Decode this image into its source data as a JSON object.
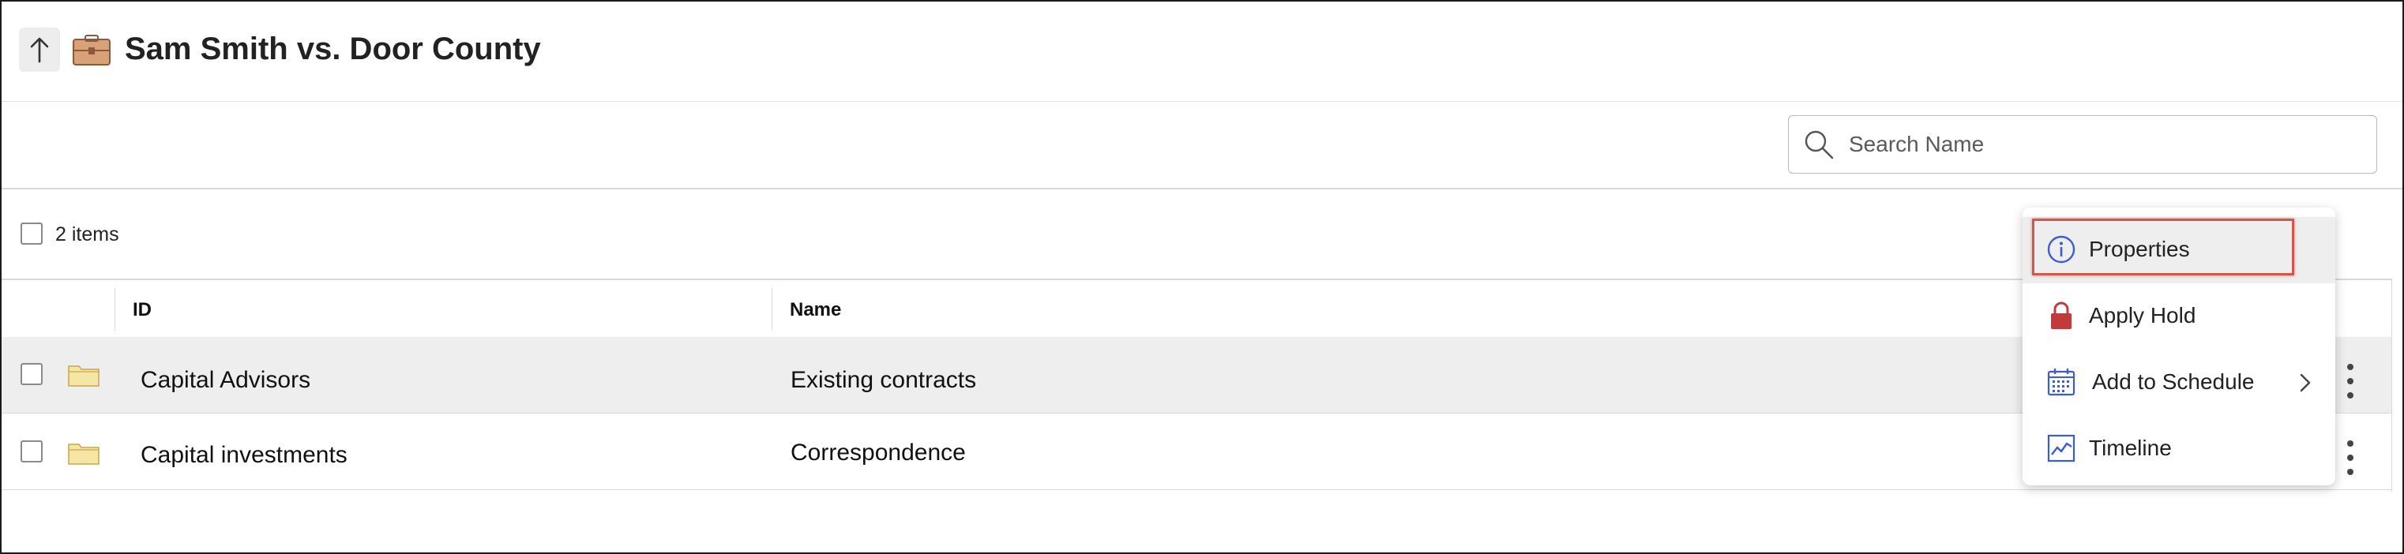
{
  "header": {
    "title": "Sam Smith vs. Door County",
    "up_icon": "arrow-up-icon",
    "case_icon": "briefcase-icon"
  },
  "search": {
    "placeholder": "Search Name",
    "value": ""
  },
  "list": {
    "count_label": "2 items"
  },
  "table": {
    "columns": [
      {
        "label": "ID"
      },
      {
        "label": "Name"
      }
    ],
    "rows": [
      {
        "id": "Capital Advisors",
        "name": "Existing contracts",
        "selected": true
      },
      {
        "id": "Capital investments",
        "name": "Correspondence",
        "selected": false
      }
    ]
  },
  "context_menu": {
    "items": [
      {
        "label": "Properties",
        "icon": "info-icon",
        "hovered": true
      },
      {
        "label": "Apply Hold",
        "icon": "lock-icon"
      },
      {
        "label": "Add to Schedule",
        "icon": "calendar-icon",
        "has_submenu": true
      },
      {
        "label": "Timeline",
        "icon": "chart-line-icon"
      }
    ]
  },
  "colors": {
    "accent_blue": "#3b5bdb",
    "lock_red": "#c23b3b",
    "highlight_border": "#d0584b",
    "folder_fill": "#f6e6a6"
  }
}
